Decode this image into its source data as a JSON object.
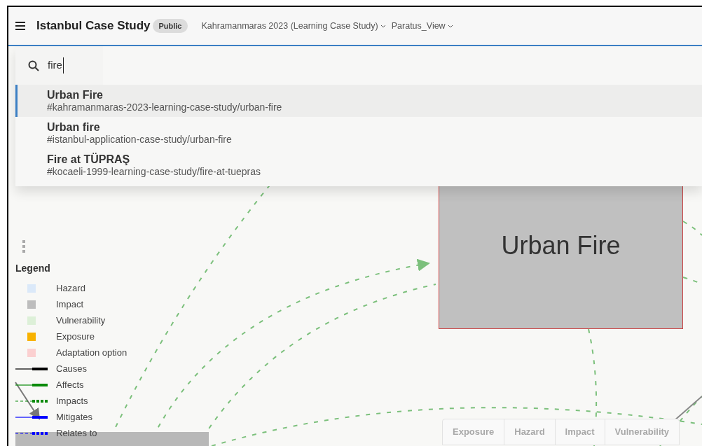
{
  "header": {
    "title": "Istanbul Case Study",
    "badge": "Public",
    "menus": [
      {
        "label": "Kahramanmaras 2023 (Learning Case Study)"
      },
      {
        "label": "Paratus_View"
      }
    ]
  },
  "search": {
    "value": "fire",
    "results": [
      {
        "title": "Urban Fire",
        "path": "#kahramanmaras-2023-learning-case-study/urban-fire",
        "selected": true
      },
      {
        "title": "Urban fire",
        "path": "#istanbul-application-case-study/urban-fire",
        "selected": false
      },
      {
        "title": "Fire at TÜPRAŞ",
        "path": "#kocaeli-1999-learning-case-study/fire-at-tuepras",
        "selected": false
      }
    ]
  },
  "node": {
    "label": "Urban Fire"
  },
  "legend": {
    "title": "Legend",
    "items": [
      {
        "label": "Hazard",
        "kind": "swatch",
        "color": "#dbe9f9"
      },
      {
        "label": "Impact",
        "kind": "swatch",
        "color": "#bdbdbd"
      },
      {
        "label": "Vulnerability",
        "kind": "swatch",
        "color": "#ddf0d8"
      },
      {
        "label": "Exposure",
        "kind": "swatch",
        "color": "#f8b200"
      },
      {
        "label": "Adaptation option",
        "kind": "swatch",
        "color": "#fbd0d0"
      },
      {
        "label": "Causes",
        "kind": "line",
        "color": "#000000"
      },
      {
        "label": "Affects",
        "kind": "line",
        "color": "#0a8a0a"
      },
      {
        "label": "Impacts",
        "kind": "dashed-line",
        "color": "#0a8a0a"
      },
      {
        "label": "Mitigates",
        "kind": "line",
        "color": "#0000ff"
      },
      {
        "label": "Relates to",
        "kind": "dashed-line",
        "color": "#0000ff"
      }
    ]
  },
  "filter_tabs": [
    {
      "label": "Exposure"
    },
    {
      "label": "Hazard"
    },
    {
      "label": "Impact"
    },
    {
      "label": "Vulnerability"
    }
  ]
}
